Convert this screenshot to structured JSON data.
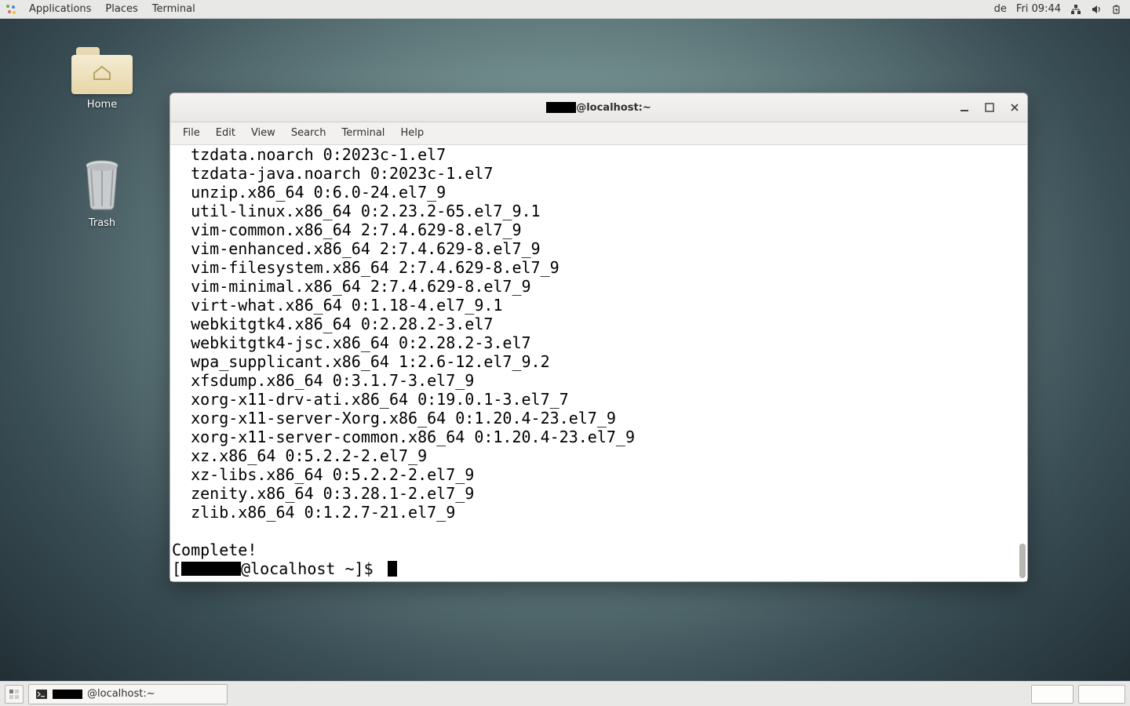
{
  "topbar": {
    "menus": [
      "Applications",
      "Places",
      "Terminal"
    ],
    "keyboard_layout": "de",
    "clock": "Fri 09:44"
  },
  "desktop": {
    "icons": [
      {
        "name": "home",
        "label": "Home"
      },
      {
        "name": "trash",
        "label": "Trash"
      }
    ]
  },
  "window": {
    "title_suffix": "@localhost:~",
    "menubar": [
      "File",
      "Edit",
      "View",
      "Search",
      "Terminal",
      "Help"
    ]
  },
  "terminal": {
    "output_lines": [
      "  tzdata.noarch 0:2023c-1.el7",
      "  tzdata-java.noarch 0:2023c-1.el7",
      "  unzip.x86_64 0:6.0-24.el7_9",
      "  util-linux.x86_64 0:2.23.2-65.el7_9.1",
      "  vim-common.x86_64 2:7.4.629-8.el7_9",
      "  vim-enhanced.x86_64 2:7.4.629-8.el7_9",
      "  vim-filesystem.x86_64 2:7.4.629-8.el7_9",
      "  vim-minimal.x86_64 2:7.4.629-8.el7_9",
      "  virt-what.x86_64 0:1.18-4.el7_9.1",
      "  webkitgtk4.x86_64 0:2.28.2-3.el7",
      "  webkitgtk4-jsc.x86_64 0:2.28.2-3.el7",
      "  wpa_supplicant.x86_64 1:2.6-12.el7_9.2",
      "  xfsdump.x86_64 0:3.1.7-3.el7_9",
      "  xorg-x11-drv-ati.x86_64 0:19.0.1-3.el7_7",
      "  xorg-x11-server-Xorg.x86_64 0:1.20.4-23.el7_9",
      "  xorg-x11-server-common.x86_64 0:1.20.4-23.el7_9",
      "  xz.x86_64 0:5.2.2-2.el7_9",
      "  xz-libs.x86_64 0:5.2.2-2.el7_9",
      "  zenity.x86_64 0:3.28.1-2.el7_9",
      "  zlib.x86_64 0:1.2.7-21.el7_9",
      ""
    ],
    "status_line": "Complete!",
    "prompt_prefix": "[",
    "prompt_suffix": "@localhost ~]$ "
  },
  "taskbar": {
    "task_suffix": "@localhost:~"
  }
}
